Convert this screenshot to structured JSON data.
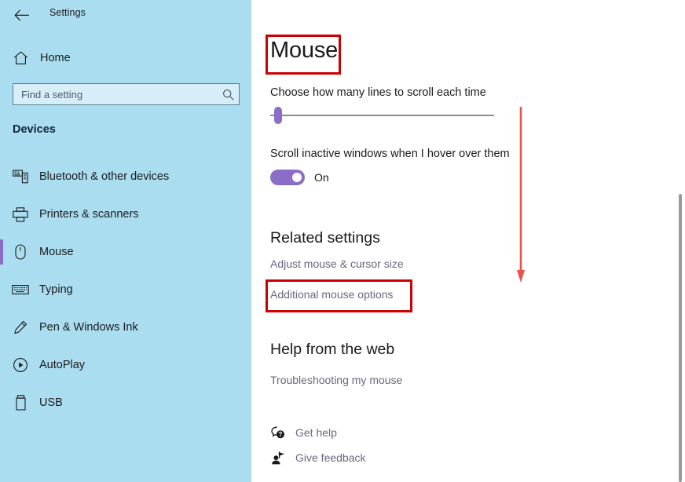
{
  "window": {
    "app_title": "Settings",
    "back_icon": "back-arrow-icon",
    "controls": {
      "minimize": "minimize-icon",
      "maximize": "maximize-icon",
      "close": "close-icon"
    }
  },
  "sidebar": {
    "home": {
      "label": "Home",
      "icon": "home-icon"
    },
    "search": {
      "placeholder": "Find a setting",
      "value": "",
      "icon": "search-icon"
    },
    "group_heading": "Devices",
    "items": [
      {
        "label": "Bluetooth & other devices",
        "icon": "bluetooth-devices-icon",
        "selected": false
      },
      {
        "label": "Printers & scanners",
        "icon": "printer-icon",
        "selected": false
      },
      {
        "label": "Mouse",
        "icon": "mouse-icon",
        "selected": true
      },
      {
        "label": "Typing",
        "icon": "keyboard-icon",
        "selected": false
      },
      {
        "label": "Pen & Windows Ink",
        "icon": "pen-icon",
        "selected": false
      },
      {
        "label": "AutoPlay",
        "icon": "autoplay-icon",
        "selected": false
      },
      {
        "label": "USB",
        "icon": "usb-icon",
        "selected": false
      }
    ],
    "accent_color": "#8a6cc4",
    "background_color": "#aaddf0"
  },
  "main": {
    "title": "Mouse",
    "scroll_lines": {
      "label": "Choose how many lines to scroll each time",
      "slider_position_percent": 3
    },
    "inactive_scroll": {
      "label": "Scroll inactive windows when I hover over them",
      "state": "On",
      "checked": true
    },
    "related": {
      "heading": "Related settings",
      "links": [
        "Adjust mouse & cursor size",
        "Additional mouse options"
      ]
    },
    "help": {
      "heading": "Help from the web",
      "links": [
        "Troubleshooting my mouse"
      ]
    },
    "footer": [
      {
        "label": "Get help",
        "icon": "get-help-icon"
      },
      {
        "label": "Give feedback",
        "icon": "give-feedback-icon"
      }
    ],
    "accent_color": "#8b6dc6"
  },
  "annotations": {
    "color": "#cc0000",
    "boxes": [
      "Mouse",
      "Additional mouse options"
    ],
    "arrow": "down-arrow-annotation"
  }
}
